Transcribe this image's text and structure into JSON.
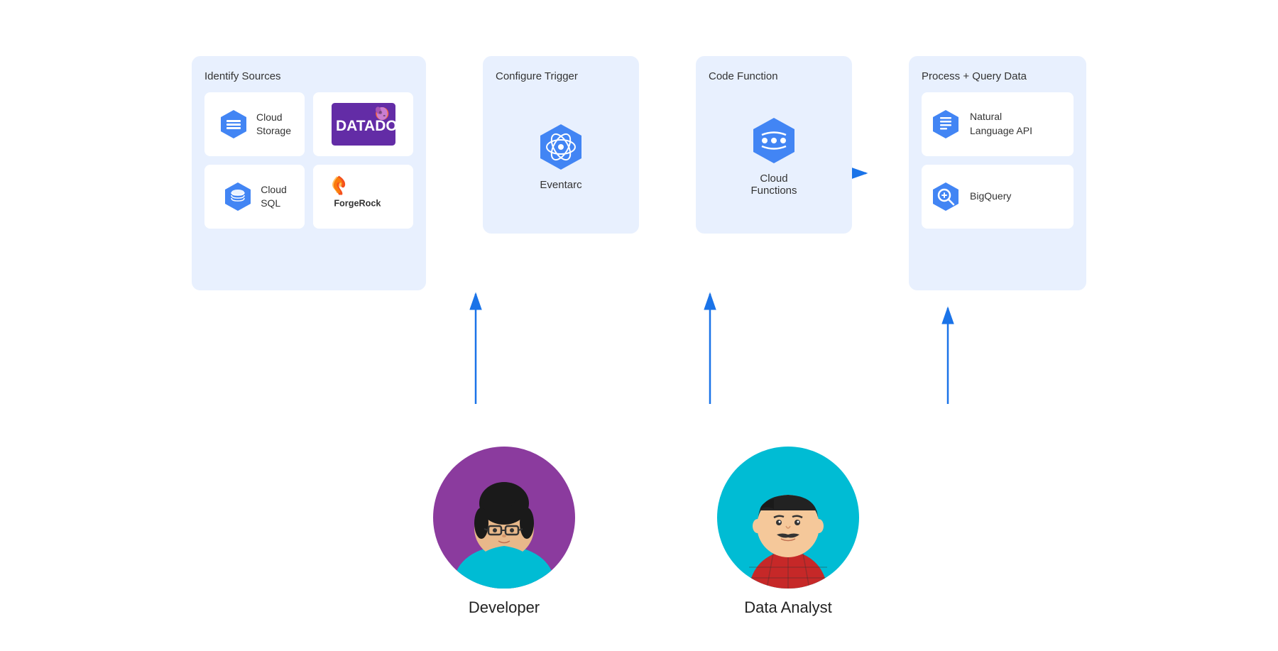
{
  "stages": {
    "identify_sources": {
      "title": "Identify Sources",
      "cards": [
        {
          "id": "cloud-storage",
          "label": "Cloud\nStorage",
          "type": "gcp",
          "icon": "cloud-storage"
        },
        {
          "id": "datadog",
          "label": "Datadog",
          "type": "logo-datadog"
        },
        {
          "id": "cloud-sql",
          "label": "Cloud\nSQL",
          "type": "gcp",
          "icon": "cloud-sql"
        },
        {
          "id": "forgerock",
          "label": "ForgeRock",
          "type": "logo-forgerock"
        }
      ]
    },
    "configure_trigger": {
      "title": "Configure Trigger",
      "service": "Eventarc",
      "icon": "eventarc"
    },
    "code_function": {
      "title": "Code Function",
      "service": "Cloud\nFunctions",
      "icon": "cloud-functions"
    },
    "process_query": {
      "title": "Process + Query Data",
      "cards": [
        {
          "id": "nlp-api",
          "label": "Natural\nLanguage API",
          "icon": "nlp"
        },
        {
          "id": "bigquery",
          "label": "BigQuery",
          "icon": "bigquery"
        }
      ]
    }
  },
  "personas": [
    {
      "id": "developer",
      "name": "Developer",
      "color": "#8b3b9e"
    },
    {
      "id": "data-analyst",
      "name": "Data Analyst",
      "color": "#00bcd4"
    }
  ],
  "colors": {
    "box_bg": "#e8f0fe",
    "card_bg": "#ffffff",
    "arrow": "#1a73e8",
    "gcp_blue": "#4285f4",
    "text_dark": "#333333"
  }
}
